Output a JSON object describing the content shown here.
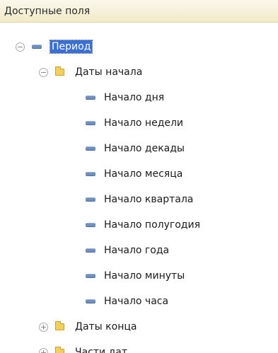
{
  "header": {
    "title": "Доступные поля"
  },
  "tree": {
    "period": {
      "label": "Период",
      "expanded": true,
      "selected": true
    },
    "start_dates": {
      "label": "Даты начала",
      "expanded": true,
      "items": [
        "Начало дня",
        "Начало недели",
        "Начало декады",
        "Начало месяца",
        "Начало квартала",
        "Начало полугодия",
        "Начало года",
        "Начало минуты",
        "Начало часа"
      ]
    },
    "end_dates": {
      "label": "Даты конца",
      "expanded": false
    },
    "date_parts": {
      "label": "Части дат",
      "expanded": false
    }
  }
}
